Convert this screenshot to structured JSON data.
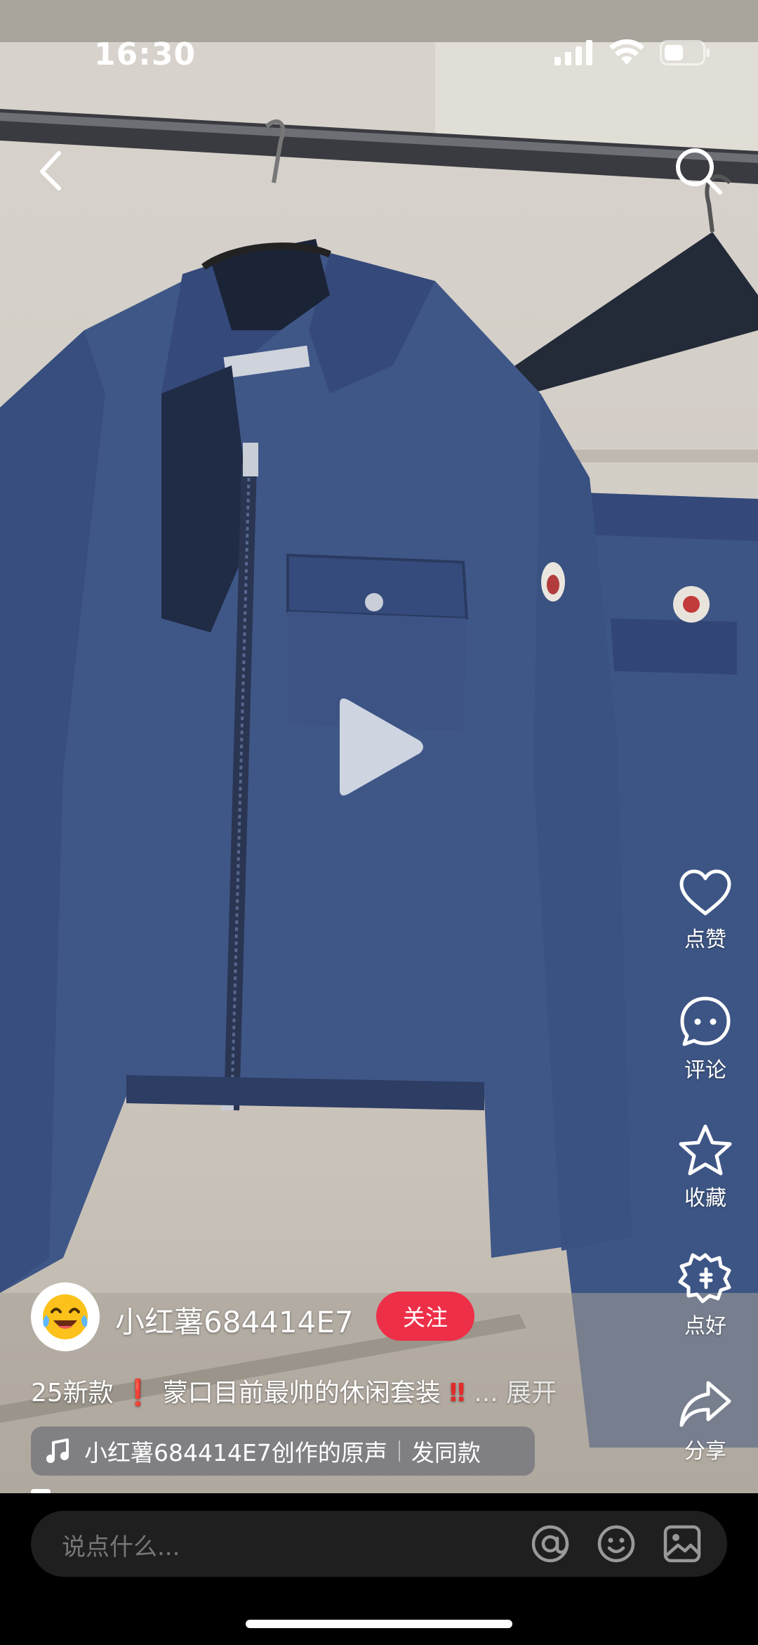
{
  "status_bar": {
    "time": "16:30"
  },
  "author": {
    "name": "小红薯684414E7",
    "follow_label": "关注"
  },
  "caption": {
    "text_a": "25新款",
    "text_b": "蒙口目前最帅的休闲套装",
    "more_label": "... 展开"
  },
  "music": {
    "track": "小红薯684414E7创作的原声",
    "same_label": "发同款"
  },
  "actions": {
    "like_label": "点赞",
    "comment_label": "评论",
    "collect_label": "收藏",
    "good_label": "点好",
    "share_label": "分享"
  },
  "comment_bar": {
    "placeholder": "说点什么..."
  }
}
